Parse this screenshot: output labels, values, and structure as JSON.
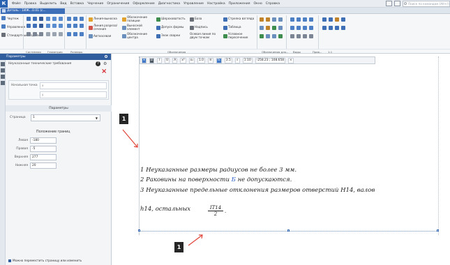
{
  "menubar": {
    "logo": "К",
    "items": [
      "Файл",
      "Правка",
      "Выделить",
      "Вид",
      "Вставка",
      "Черчение",
      "Ограничения",
      "Оформление",
      "Диагностика",
      "Управление",
      "Настройка",
      "Приложения",
      "Окно",
      "Справка"
    ],
    "search_placeholder": "Поиск по командам (Alt+/)"
  },
  "tabstrip": {
    "doc_tab_label": "Деталь - 1ИЖ...0.01 (с...",
    "close": "×"
  },
  "ribbon": {
    "left_items": [
      "Чертеж",
      "Управление",
      "Стандартные изделия"
    ],
    "labels": {
      "line_leader": "Линия-выноска",
      "leader_position": "Обозначение позиции",
      "cut_line": "Линия разреза/ сечения",
      "view_arrow": "Выносной элемент",
      "autoaxis": "Автоосевая",
      "center_mark": "Обозначение центра",
      "roughness": "Шероховатость",
      "base": "База",
      "tolerance": "Допуск формы",
      "inscription": "Надпись",
      "weld_mark": "Знак сварки",
      "conditional": "Осевая линия по двум точкам",
      "reference": "Условное пересечение",
      "table_text": "Таблица",
      "jump_table": "Стрелка взгляда"
    },
    "footer": {
      "systems": "Системная",
      "geometry": "Геометрия",
      "dimensions": "Размеры",
      "marks": "Обозначения",
      "design_marks": "Обозначения для...",
      "views": "Виды",
      "edit": "Прав...",
      "zoom": "1:1"
    }
  },
  "panel": {
    "title": "Параметры",
    "subtitle": "Неуказанные технические требования",
    "help": "?",
    "cancel": "×",
    "xy": {
      "label": "Начальная точка",
      "x_label": "x",
      "y_label": "y"
    },
    "params_header": "Параметры",
    "page_label": "Страница",
    "page_value": "1",
    "position_title": "Положение границ",
    "rows": [
      {
        "label": "Левая",
        "value": "-180"
      },
      {
        "label": "Правая",
        "value": "-5"
      },
      {
        "label": "Верхняя",
        "value": "277"
      },
      {
        "label": "Нижняя",
        "value": "20"
      }
    ],
    "footer": "Можно переместить страницу или изменить"
  },
  "text_toolbar": {
    "font_size": "3.5",
    "line_step": "1.0",
    "zoom": "1:10",
    "coords": "-258.23 ; 108.658",
    "buttons": [
      "B",
      "I",
      "U",
      "A",
      "S",
      "x²",
      "x₂",
      "fx",
      "≡"
    ]
  },
  "notes": {
    "line1": "1 Неуказанные размеры радиусов не более 3 мм.",
    "line2_a": "2 Раковины на поверхности ",
    "line2_b": "Б",
    "line2_c": " не допускаются.",
    "line3": "3 Неуказанные предельные отклонения размеров отверстий H14, валов",
    "line4": "h14, остальных",
    "frac_num": "IT14",
    "frac_den": "2",
    "frac_tail": "."
  },
  "callouts": {
    "top": "1",
    "bottom": "1"
  },
  "colors": {
    "accent": "#2f5d9e",
    "callout": "#262626",
    "arrow": "#e0463a",
    "cancel": "#d4252c",
    "blue_text": "#2f63c9"
  }
}
